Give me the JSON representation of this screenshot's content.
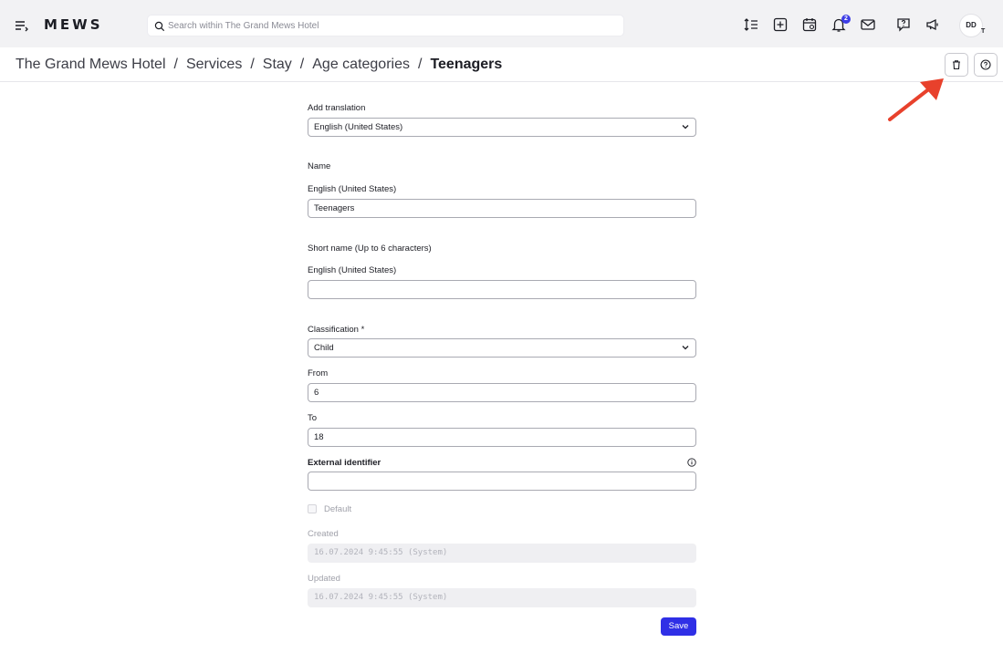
{
  "app": {
    "logo": "MEWS"
  },
  "search": {
    "placeholder": "Search within The Grand Mews Hotel"
  },
  "notifications": {
    "count": "2"
  },
  "user": {
    "initials": "DD",
    "sub": "T"
  },
  "breadcrumb": {
    "items": [
      "The Grand Mews Hotel",
      "Services",
      "Stay",
      "Age categories"
    ],
    "separator": "/",
    "current": "Teenagers"
  },
  "form": {
    "add_translation_label": "Add translation",
    "add_translation_value": "English (United States)",
    "name_section": "Name",
    "name_lang_label": "English (United States)",
    "name_value": "Teenagers",
    "short_name_section": "Short name (Up to 6 characters)",
    "short_name_lang_label": "English (United States)",
    "short_name_value": "",
    "classification_label": "Classification *",
    "classification_value": "Child",
    "from_label": "From",
    "from_value": "6",
    "to_label": "To",
    "to_value": "18",
    "external_id_label": "External identifier",
    "external_id_value": "",
    "default_label": "Default",
    "created_label": "Created",
    "created_value": "16.07.2024 9:45:55 (System)",
    "updated_label": "Updated",
    "updated_value": "16.07.2024 9:45:55 (System)",
    "save_label": "Save"
  },
  "colors": {
    "accent": "#2f2fe6",
    "annotation": "#e8412c"
  }
}
